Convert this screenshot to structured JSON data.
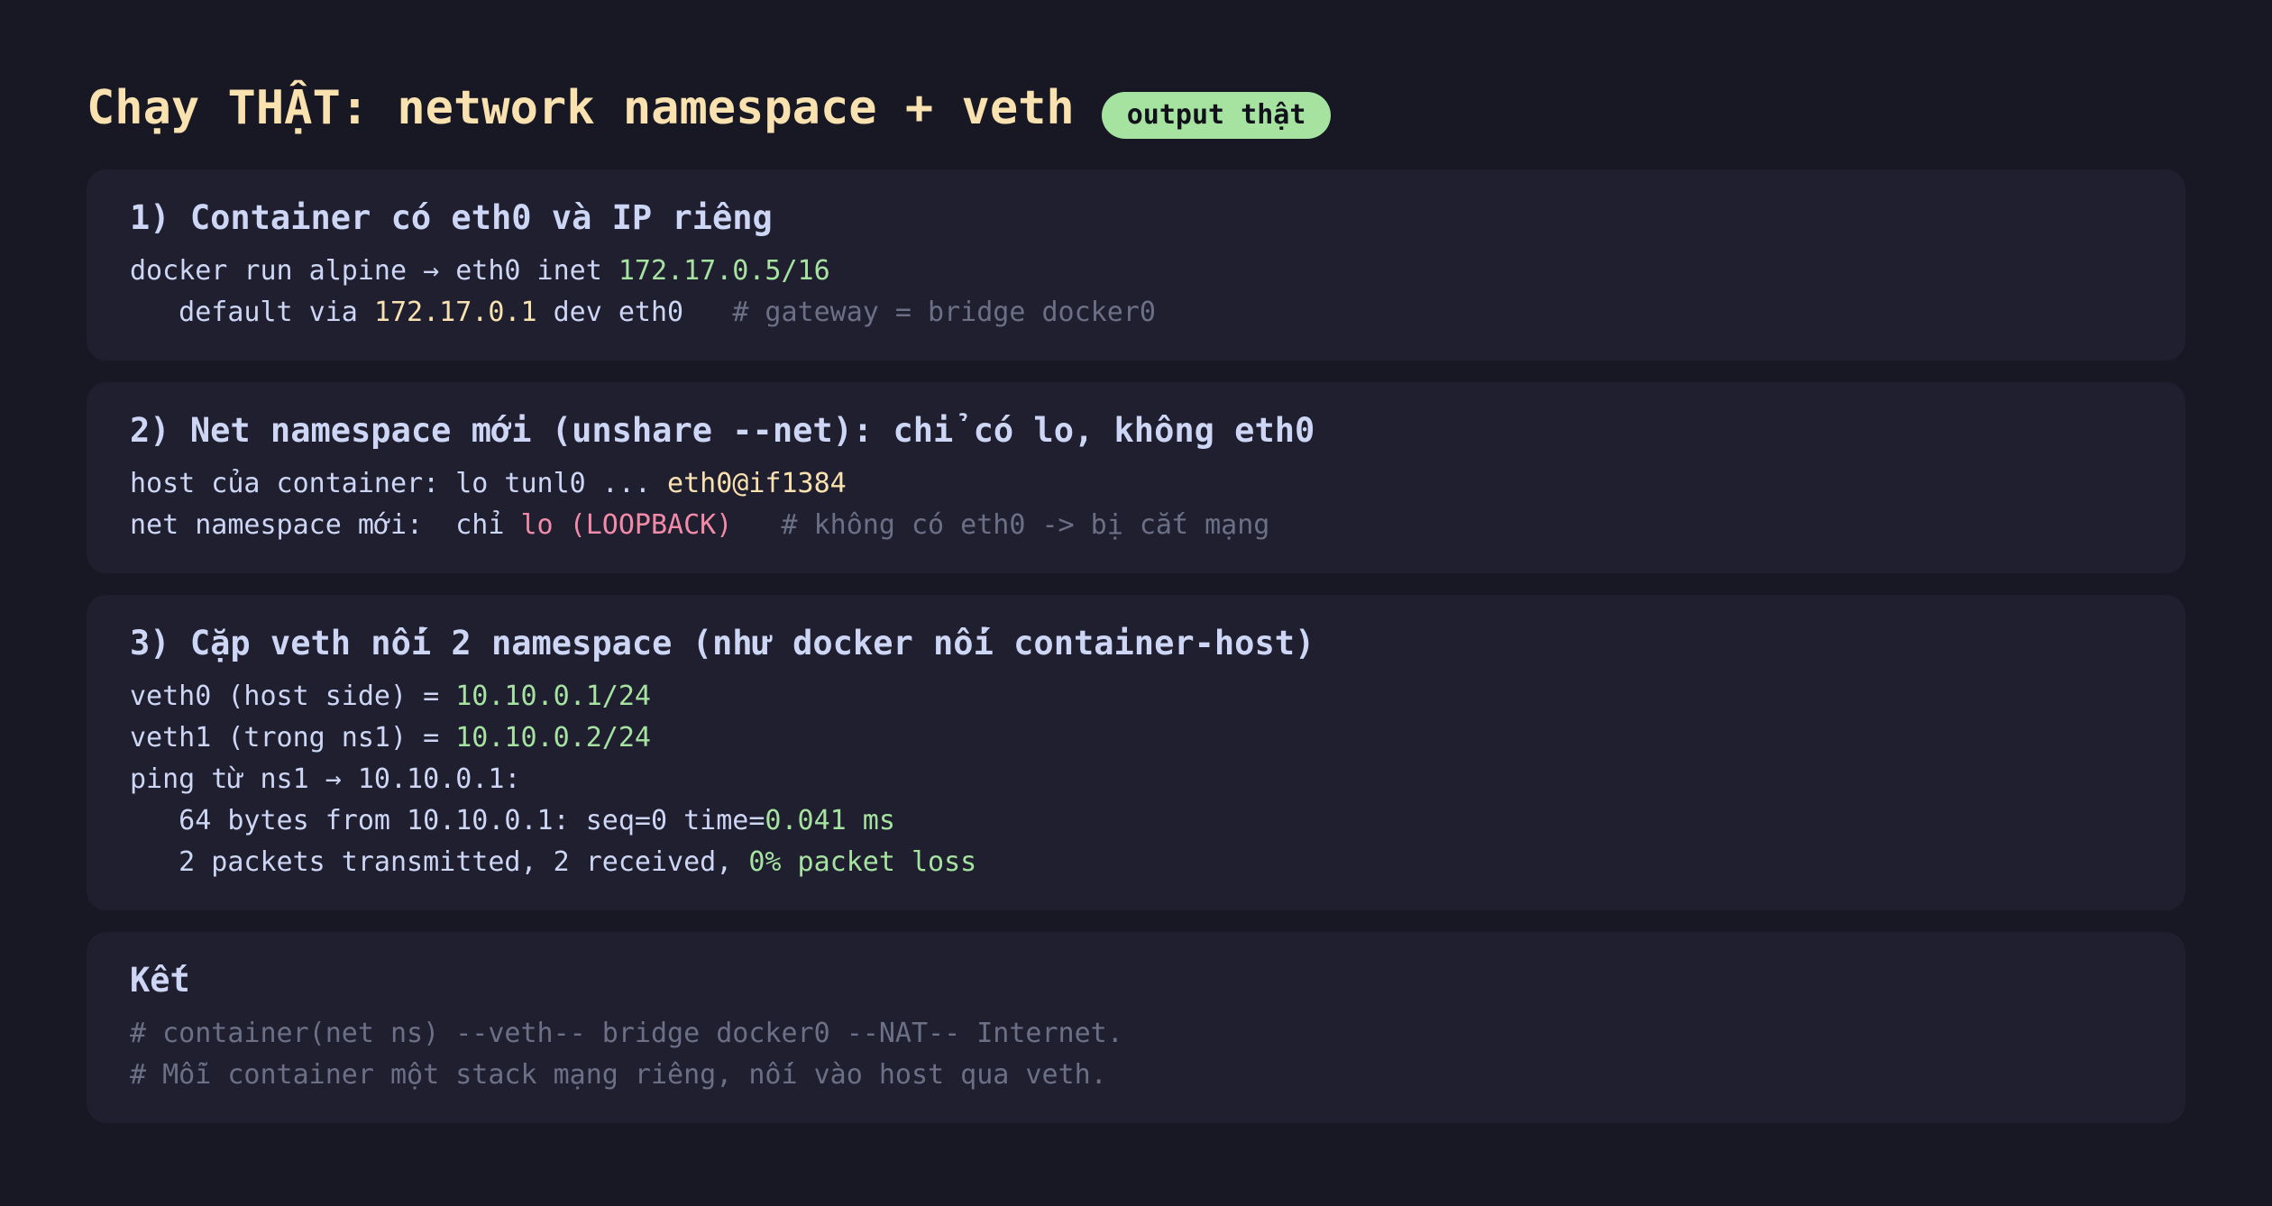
{
  "header": {
    "title": "Chạy THẬT: network namespace + veth",
    "badge": "output thật"
  },
  "cards": [
    {
      "title": "1) Container có eth0 và IP riêng",
      "lines": [
        [
          {
            "text": "docker run alpine → eth0 inet ",
            "style": "plain"
          },
          {
            "text": "172.17.0.5/16",
            "style": "green"
          }
        ],
        [
          {
            "text": "   default via ",
            "style": "plain"
          },
          {
            "text": "172.17.0.1",
            "style": "yellow"
          },
          {
            "text": " dev eth0   ",
            "style": "plain"
          },
          {
            "text": "# gateway = bridge docker0",
            "style": "gray"
          }
        ]
      ]
    },
    {
      "title": "2) Net namespace mới (unshare --net): chỉ có lo, không eth0",
      "lines": [
        [
          {
            "text": "host của container: lo tunl0 ... ",
            "style": "plain"
          },
          {
            "text": "eth0@if1384",
            "style": "yellow"
          }
        ],
        [
          {
            "text": "net namespace mới:  chỉ ",
            "style": "plain"
          },
          {
            "text": "lo (LOOPBACK)",
            "style": "pink"
          },
          {
            "text": "   ",
            "style": "plain"
          },
          {
            "text": "# không có eth0 -> bị cắt mạng",
            "style": "gray"
          }
        ]
      ]
    },
    {
      "title": "3) Cặp veth nối 2 namespace (như docker nối container-host)",
      "lines": [
        [
          {
            "text": "veth0 (host side) = ",
            "style": "plain"
          },
          {
            "text": "10.10.0.1/24",
            "style": "green"
          }
        ],
        [
          {
            "text": "veth1 (trong ns1) = ",
            "style": "plain"
          },
          {
            "text": "10.10.0.2/24",
            "style": "green"
          }
        ],
        [
          {
            "text": "ping từ ns1 → 10.10.0.1:",
            "style": "plain"
          }
        ],
        [
          {
            "text": "   64 bytes from 10.10.0.1: seq=0 time=",
            "style": "plain"
          },
          {
            "text": "0.041 ms",
            "style": "green"
          }
        ],
        [
          {
            "text": "   2 packets transmitted, 2 received, ",
            "style": "plain"
          },
          {
            "text": "0% packet loss",
            "style": "green"
          }
        ]
      ]
    },
    {
      "title": "Kết",
      "lines": [
        [
          {
            "text": "# container(net ns) --veth-- bridge docker0 --NAT-- Internet.",
            "style": "gray"
          }
        ],
        [
          {
            "text": "# Mỗi container một stack mạng riêng, nối vào host qua veth.",
            "style": "gray"
          }
        ]
      ]
    }
  ],
  "colors": {
    "background": "#181825",
    "card": "#1f1f30",
    "title": "#f9e2af",
    "badge": "#a6e3a1",
    "green": "#a6e3a1",
    "yellow": "#f9e2af",
    "pink": "#f38ba8",
    "comment": "#6c7086"
  }
}
